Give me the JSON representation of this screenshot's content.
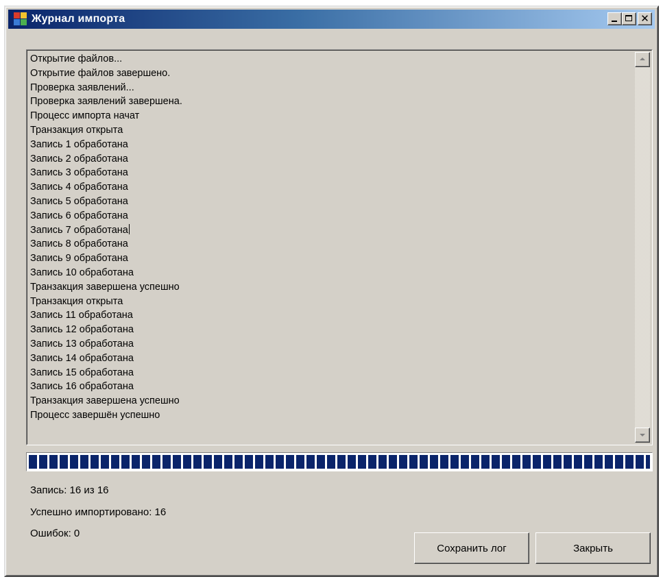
{
  "window": {
    "title": "Журнал импорта",
    "icon": "application-icon",
    "controls": {
      "minimize": "minimize-icon",
      "maximize": "maximize-icon",
      "close": "close-icon"
    }
  },
  "log": {
    "lines": [
      "Открытие файлов...",
      "Открытие файлов завершено.",
      "Проверка заявлений...",
      "Проверка заявлений завершена.",
      "Процесс импорта начат",
      "Транзакция открыта",
      "Запись 1 обработана",
      "Запись 2 обработана",
      "Запись 3 обработана",
      "Запись 4 обработана",
      "Запись 5 обработана",
      "Запись 6 обработана",
      "Запись 7 обработана",
      "Запись 8 обработана",
      "Запись 9 обработана",
      "Запись 10 обработана",
      "Транзакция завершена успешно",
      "Транзакция открыта",
      "Запись 11 обработана",
      "Запись 12 обработана",
      "Запись 13 обработана",
      "Запись 14 обработана",
      "Запись 15 обработана",
      "Запись 16 обработана",
      "Транзакция завершена успешно",
      "Процесс завершён успешно"
    ]
  },
  "progress": {
    "fraction": 1.0,
    "color": "#0a246a"
  },
  "status": {
    "record": "Запись: 16 из 16",
    "imported": "Успешно импортировано: 16",
    "errors": "Ошибок: 0"
  },
  "buttons": {
    "save_log": "Сохранить лог",
    "close": "Закрыть"
  },
  "colors": {
    "window_bg": "#d4d0c8",
    "title_start": "#0a246a",
    "title_end": "#a6caf0"
  }
}
